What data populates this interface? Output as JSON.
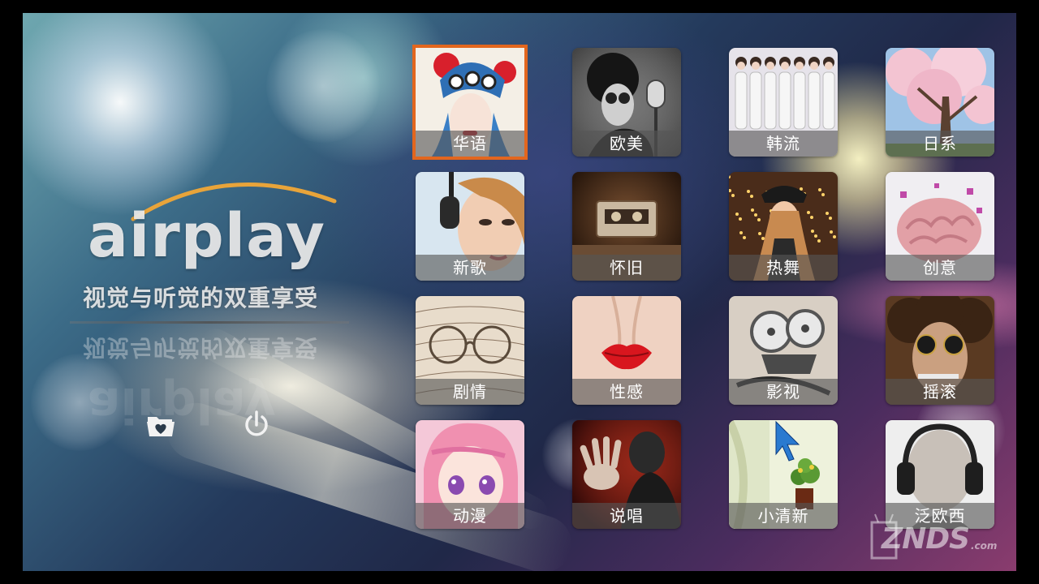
{
  "app": {
    "brand": "airplay",
    "slogan": "视觉与听觉的双重享受"
  },
  "controls": [
    {
      "name": "favorites",
      "icon": "folder-heart-icon"
    },
    {
      "name": "power",
      "icon": "power-icon"
    }
  ],
  "categories": [
    {
      "label": "华语",
      "selected": true
    },
    {
      "label": "欧美",
      "selected": false
    },
    {
      "label": "韩流",
      "selected": false
    },
    {
      "label": "日系",
      "selected": false
    },
    {
      "label": "新歌",
      "selected": false
    },
    {
      "label": "怀旧",
      "selected": false
    },
    {
      "label": "热舞",
      "selected": false
    },
    {
      "label": "创意",
      "selected": false
    },
    {
      "label": "剧情",
      "selected": false
    },
    {
      "label": "性感",
      "selected": false
    },
    {
      "label": "影视",
      "selected": false
    },
    {
      "label": "摇滚",
      "selected": false
    },
    {
      "label": "动漫",
      "selected": false
    },
    {
      "label": "说唱",
      "selected": false
    },
    {
      "label": "小清新",
      "selected": false
    },
    {
      "label": "泛欧西",
      "selected": false
    }
  ],
  "watermark": {
    "text": "ZNDS",
    "sub": ".com"
  },
  "colors": {
    "selection": "#e2661e",
    "logo_arc": "#e8a43a"
  }
}
